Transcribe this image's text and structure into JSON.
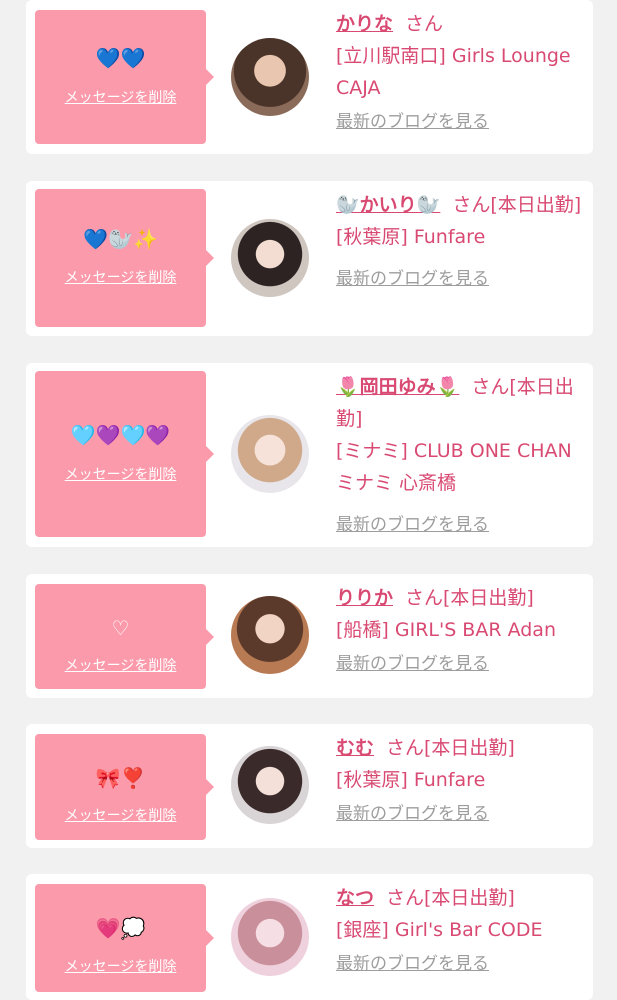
{
  "delete_label": "メッセージを削除",
  "blog_label": "最新のブログを見る",
  "items": [
    {
      "emoji": "💙💙",
      "name": "かりな",
      "suffix": "さん",
      "shop": "[立川駅南口] Girls Lounge CAJA"
    },
    {
      "emoji": "💙🦭✨",
      "name": "🦭かいり🦭",
      "suffix": "さん[本日出勤]",
      "shop": "[秋葉原] Funfare"
    },
    {
      "emoji": "🩵💜🩵💜",
      "name": "🌷岡田ゆみ🌷",
      "suffix": "さん[本日出勤]",
      "shop": "[ミナミ] CLUB ONE CHAN ミナミ 心斎橋"
    },
    {
      "emoji": "♡",
      "name": "りりか",
      "suffix": "さん[本日出勤]",
      "shop": "[船橋] GIRL'S BAR Adan"
    },
    {
      "emoji": "🎀❣️",
      "name": "むむ",
      "suffix": "さん[本日出勤]",
      "shop": "[秋葉原] Funfare"
    },
    {
      "emoji": "💗💭",
      "name": "なつ",
      "suffix": "さん[本日出勤]",
      "shop": "[銀座] Girl's Bar CODE"
    }
  ],
  "colors": {
    "bubble": "#fb9aab",
    "name": "#d94a73",
    "blog": "#9d9d9d",
    "background": "#f1f1f1"
  }
}
